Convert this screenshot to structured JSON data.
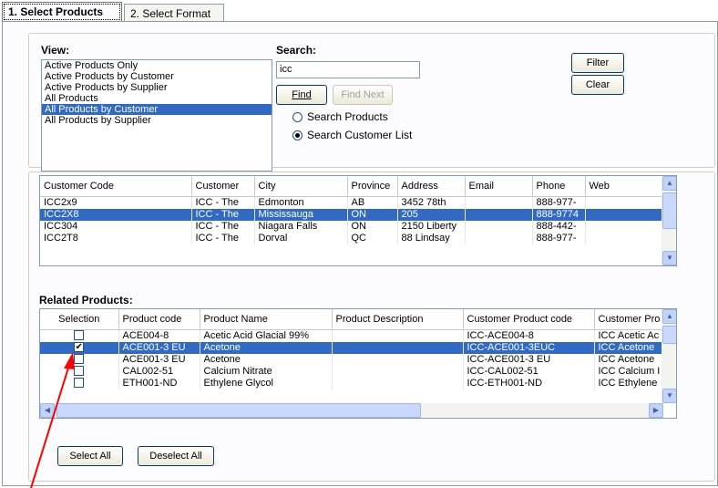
{
  "tabs": [
    {
      "label": "1. Select Products"
    },
    {
      "label": "2. Select Format"
    }
  ],
  "view": {
    "label": "View:",
    "items": [
      "Active Products Only",
      "Active Products by Customer",
      "Active Products by Supplier",
      "All Products",
      "All Products by Customer",
      "All Products by Supplier"
    ],
    "selected_index": 4
  },
  "search": {
    "label": "Search:",
    "value": "icc",
    "find_label": "Find",
    "find_next_label": "Find Next",
    "radio_products": "Search Products",
    "radio_customers": "Search Customer List",
    "selected": "customers"
  },
  "buttons": {
    "filter": "Filter",
    "clear": "Clear",
    "select_all": "Select All",
    "deselect_all": "Deselect All"
  },
  "customers": {
    "columns": [
      "Customer Code",
      "Customer",
      "City",
      "Province",
      "Address",
      "Email",
      "Phone",
      "Web"
    ],
    "rows": [
      [
        "ICC2x9",
        "ICC - The",
        "Edmonton",
        "AB",
        "3452 78th",
        "",
        "888-977-",
        ""
      ],
      [
        "ICC2X8",
        "ICC - The",
        "Mississauga",
        "ON",
        "205",
        "",
        "888-9774",
        ""
      ],
      [
        "ICC304",
        "ICC - The",
        "Niagara Falls",
        "ON",
        "2150 Liberty",
        "",
        "888-442-",
        ""
      ],
      [
        "ICC2T8",
        "ICC - The",
        "Dorval",
        "QC",
        "88 Lindsay",
        "",
        "888-977-",
        ""
      ]
    ],
    "selected_index": 1
  },
  "related": {
    "label": "Related Products:",
    "columns": [
      "Selection",
      "Product code",
      "Product Name",
      "Product Description",
      "Customer Product code",
      "Customer Pro"
    ],
    "rows": [
      {
        "checked": false,
        "cells": [
          "ACE004-8",
          "Acetic Acid Glacial 99%",
          "",
          "ICC-ACE004-8",
          "ICC Acetic Ac"
        ]
      },
      {
        "checked": true,
        "cells": [
          "ACE001-3 EU",
          "Acetone",
          "",
          "ICC-ACE001-3EUC",
          "ICC Acetone"
        ]
      },
      {
        "checked": false,
        "cells": [
          "ACE001-3 EU",
          "Acetone",
          "",
          "ICC-ACE001-3 EU",
          "ICC Acetone"
        ]
      },
      {
        "checked": false,
        "cells": [
          "CAL002-51",
          "Calcium Nitrate",
          "",
          "ICC-CAL002-51",
          "ICC Calcium I"
        ]
      },
      {
        "checked": false,
        "cells": [
          "ETH001-ND",
          "Ethylene Glycol",
          "",
          "ICC-ETH001-ND",
          "ICC Ethylene"
        ]
      }
    ],
    "selected_index": 1
  },
  "colors": {
    "selection": "#316ac5",
    "arrow": "#ff0000"
  }
}
